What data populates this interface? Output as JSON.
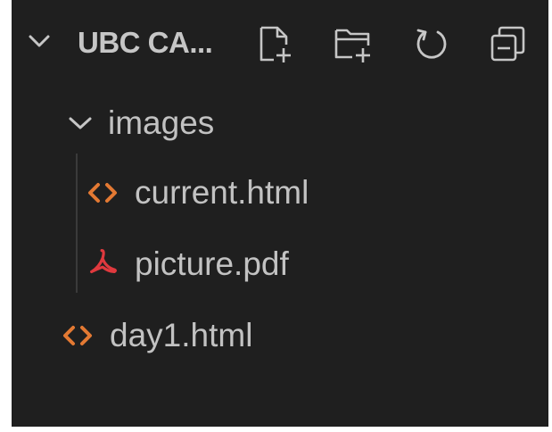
{
  "explorer": {
    "title": "UBC CA...",
    "actions": [
      {
        "name": "new-file",
        "icon": "new-file-icon"
      },
      {
        "name": "new-folder",
        "icon": "new-folder-icon"
      },
      {
        "name": "refresh",
        "icon": "refresh-icon"
      },
      {
        "name": "collapse-all",
        "icon": "collapse-all-icon"
      }
    ]
  },
  "tree": {
    "folder": {
      "label": "images",
      "expanded": true,
      "icon": "chevron-down-icon"
    },
    "children": [
      {
        "label": "current.html",
        "icon": "html-file-icon",
        "icon_color": "#e37933"
      },
      {
        "label": "picture.pdf",
        "icon": "pdf-file-icon",
        "icon_color": "#e0393e"
      }
    ],
    "root_files": [
      {
        "label": "day1.html",
        "icon": "html-file-icon",
        "icon_color": "#e37933"
      }
    ]
  },
  "colors": {
    "background": "#1f1f1f",
    "text": "#c2c2c2",
    "html_icon": "#e37933",
    "pdf_icon": "#e0393e"
  }
}
